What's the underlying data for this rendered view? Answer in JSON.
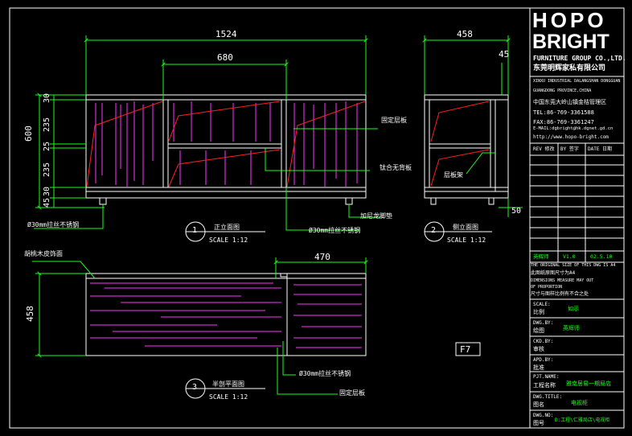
{
  "brand": {
    "line1": "HOPO",
    "line2": "BRIGHT",
    "company_en": "FURNITURE GROUP CO.,LTD.",
    "company_cn": "东莞明辉家私有限公司"
  },
  "address": {
    "en1": "XINXU INDUSTRIAL DALANGSHAN DONGGUAN",
    "en2": "GUANGDONG PROVINCE,CHINA",
    "cn": "中国东莞大岭山镇金桔管理区",
    "tel": "TEL:86-769-3361588",
    "fax": "FAX:86-769-3361247",
    "email": "E-MAIL:dgbright@hk.dgnet.gd.cn",
    "web": "http://www.hopo-bright.com"
  },
  "revision": {
    "rev": "REV 修改",
    "by": "BY 签字",
    "date": "DATE 日期",
    "designer": "英辉师",
    "version": "V1.0",
    "rev_date": "02.5.10"
  },
  "notes": {
    "n1": "THE ORIGINAL SIZE OF THIS DWG IS A4",
    "n2": "此图纸原图尺寸为A4",
    "n3": "DIMENSIONS MEASURE MAY OUT",
    "n4": "OF PROPORTION",
    "n5": "尺寸与图样比例有不合之处"
  },
  "fields": {
    "scale_en": "SCALE:",
    "scale_cn": "比例",
    "scale_val": "如示",
    "dwn_en": "DWG.BY:",
    "dwn_cn": "绘图",
    "dwn_val": "英辉师",
    "chk_en": "CKD.BY:",
    "chk_cn": "审核",
    "apd_en": "APD.BY:",
    "apd_cn": "批准",
    "prj_en": "PJT.NAME:",
    "prj_cn": "工程名称",
    "prj_val": "雅南居易一期局店",
    "ttl_en": "DWG.TITLE:",
    "ttl_cn": "图名",
    "ttl_val": "电视柜",
    "no_en": "DWG.NO:",
    "no_cn": "图号",
    "no_val": "D:工程\\仁雅局店\\电视柜"
  },
  "views": {
    "front": {
      "num": "1",
      "title": "正立面图",
      "scale": "SCALE 1:12"
    },
    "side": {
      "num": "2",
      "title": "侧立面图",
      "scale": "SCALE 1:12"
    },
    "plan": {
      "num": "3",
      "title": "半剖平面图",
      "scale": "SCALE 1:12"
    }
  },
  "dims": {
    "front_w": "1524",
    "front_inner": "680",
    "side_w": "458",
    "side_top": "45",
    "height": "600",
    "d30a": "30",
    "d235a": "235",
    "d25": "25",
    "d235b": "235",
    "d30b": "30",
    "d45": "45",
    "side_bottom": "50",
    "plan_w": "470",
    "plan_h": "458"
  },
  "labels": {
    "fixed_shelf": "固定层板",
    "glass_door": "钛合无背板",
    "shelf": "层板架",
    "leg": "加尼龙脚垫",
    "tube_front": "Ø30mm拉丝不锈钢",
    "tube_left": "Ø30mm拉丝不锈钢",
    "plan_surface": "胡桃木皮饰面",
    "plan_tube": "Ø30mm拉丝不锈钢",
    "plan_shelf": "固定层板",
    "sheet_code": "F7"
  },
  "colors": {
    "line": "#ffffff",
    "dim": "#19ff19",
    "red": "#ff2020",
    "magenta": "#ff33ff"
  }
}
